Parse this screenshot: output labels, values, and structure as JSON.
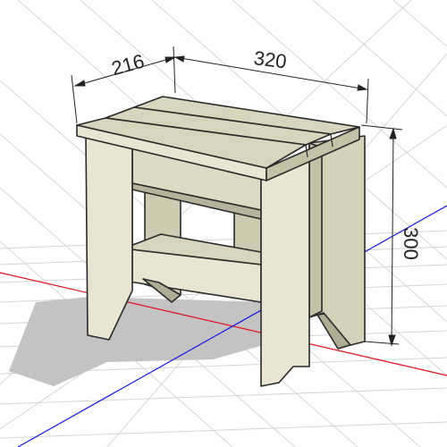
{
  "scene": {
    "model": "stool",
    "dimensions": {
      "depth": "216",
      "width": "320",
      "height": "300"
    }
  },
  "colors": {
    "background": "#ffffff",
    "grid_line": "#d4d4d4",
    "axis_x": "#e0101a",
    "axis_y": "#1a1ae0",
    "shadow": "#c3c3c3",
    "wood_front": "#e8e6d2",
    "wood_top": "#d7d5bc",
    "wood_side": "#c3c1a6",
    "wood_dark": "#aeac92",
    "outline": "#2a2a2a",
    "dimension_line": "#222222"
  }
}
